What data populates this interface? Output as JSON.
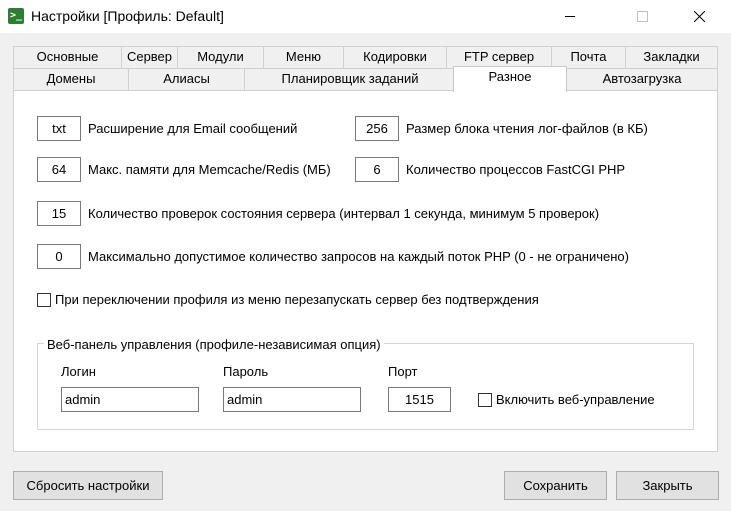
{
  "window": {
    "title": "Настройки [Профиль: Default]",
    "icon_glyph": ">_"
  },
  "tabs": {
    "row1": [
      {
        "label": "Основные"
      },
      {
        "label": "Сервер"
      },
      {
        "label": "Модули"
      },
      {
        "label": "Меню"
      },
      {
        "label": "Кодировки"
      },
      {
        "label": "FTP сервер"
      },
      {
        "label": "Почта"
      },
      {
        "label": "Закладки"
      }
    ],
    "row2": [
      {
        "label": "Домены"
      },
      {
        "label": "Алиасы"
      },
      {
        "label": "Планировщик заданий"
      },
      {
        "label": "Разное"
      },
      {
        "label": "Автозагрузка"
      }
    ],
    "active": "Разное"
  },
  "settings": {
    "email_ext": {
      "value": "txt",
      "label": "Расширение для Email сообщений"
    },
    "log_block": {
      "value": "256",
      "label": "Размер блока чтения лог-файлов (в КБ)"
    },
    "memcache": {
      "value": "64",
      "label": "Макс. памяти для Memcache/Redis (МБ)"
    },
    "fastcgi": {
      "value": "6",
      "label": "Количество процессов FastCGI PHP"
    },
    "health_checks": {
      "value": "15",
      "label": "Количество проверок состояния сервера (интервал 1 секунда, минимум 5 проверок)"
    },
    "max_requests": {
      "value": "0",
      "label": "Максимально допустимое количество запросов на каждый поток PHP (0 - не ограничено)"
    },
    "restart_no_confirm": {
      "label": "При переключении профиля из меню перезапускать сервер без подтверждения",
      "checked": false
    }
  },
  "web_panel": {
    "title": "Веб-панель управления (профиле-независимая опция)",
    "login_label": "Логин",
    "login_value": "admin",
    "password_label": "Пароль",
    "password_value": "admin",
    "port_label": "Порт",
    "port_value": "1515",
    "enable_label": "Включить веб-управление",
    "enable_checked": false
  },
  "buttons": {
    "reset": "Сбросить настройки",
    "save": "Сохранить",
    "close": "Закрыть"
  },
  "colors": {
    "window_bg": "#f0f0f0",
    "panel_bg": "#ffffff",
    "button_bg": "#e1e1e1",
    "icon_green": "#2e7d32"
  }
}
